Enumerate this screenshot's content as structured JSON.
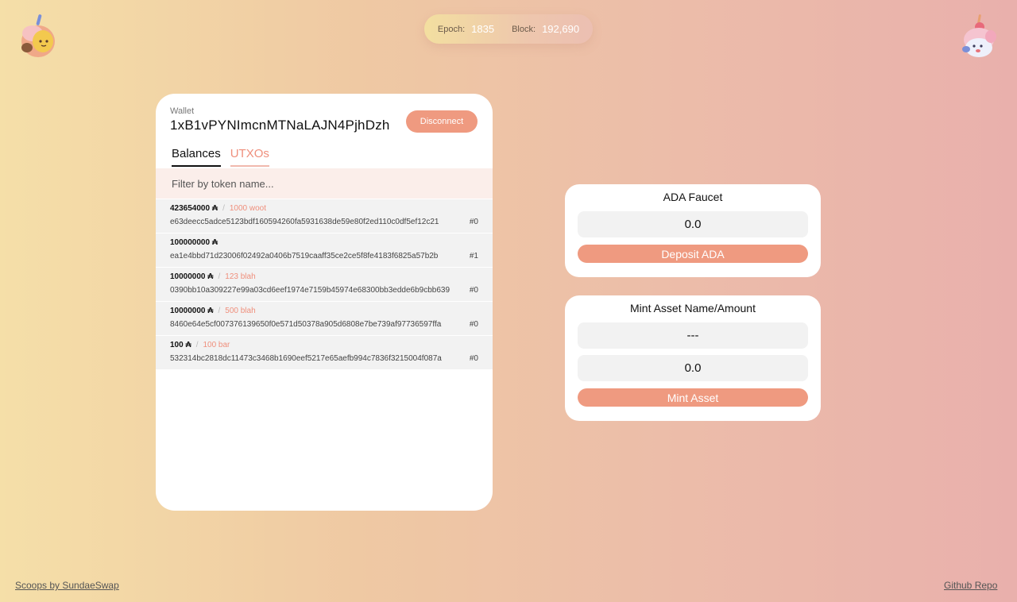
{
  "header": {
    "epoch_label": "Epoch:",
    "epoch_value": "1835",
    "block_label": "Block:",
    "block_value": "192,690"
  },
  "wallet": {
    "label": "Wallet",
    "address": "1xB1vPYNImcnMTNaLAJN4PjhDzh",
    "disconnect_label": "Disconnect",
    "tabs": [
      {
        "label": "Balances",
        "active": true
      },
      {
        "label": "UTXOs",
        "active": false
      }
    ],
    "filter_placeholder": "Filter by token name...",
    "utxos": [
      {
        "amount": "423654000 ₳",
        "asset": "1000 woot",
        "hash": "e63deecc5adce5123bdf160594260fa5931638de59e80f2ed110c0df5ef12c21",
        "index": "#0"
      },
      {
        "amount": "100000000 ₳",
        "asset": "",
        "hash": "ea1e4bbd71d23006f02492a0406b7519caaff35ce2ce5f8fe4183f6825a57b2b",
        "index": "#1"
      },
      {
        "amount": "10000000 ₳",
        "asset": "123 blah",
        "hash": "0390bb10a309227e99a03cd6eef1974e7159b45974e68300bb3edde6b9cbb639",
        "index": "#0"
      },
      {
        "amount": "10000000 ₳",
        "asset": "500 blah",
        "hash": "8460e64e5cf007376139650f0e571d50378a905d6808e7be739af97736597ffa",
        "index": "#0"
      },
      {
        "amount": "100 ₳",
        "asset": "100 bar",
        "hash": "532314bc2818dc11473c3468b1690eef5217e65aefb994c7836f3215004f087a",
        "index": "#0"
      }
    ]
  },
  "faucet": {
    "title": "ADA Faucet",
    "amount_value": "0.0",
    "button_label": "Deposit ADA"
  },
  "mint": {
    "title": "Mint Asset Name/Amount",
    "name_value": "---",
    "amount_value": "0.0",
    "button_label": "Mint Asset"
  },
  "footer": {
    "left_link": "Scoops by SundaeSwap",
    "right_link": "Github Repo"
  },
  "colors": {
    "accent": "#ef9a80",
    "asset_text": "#ef8f7c"
  },
  "icons": {
    "left_mascot": "sundae-mascot-icon",
    "right_mascot": "ice-cream-mascot-icon"
  }
}
